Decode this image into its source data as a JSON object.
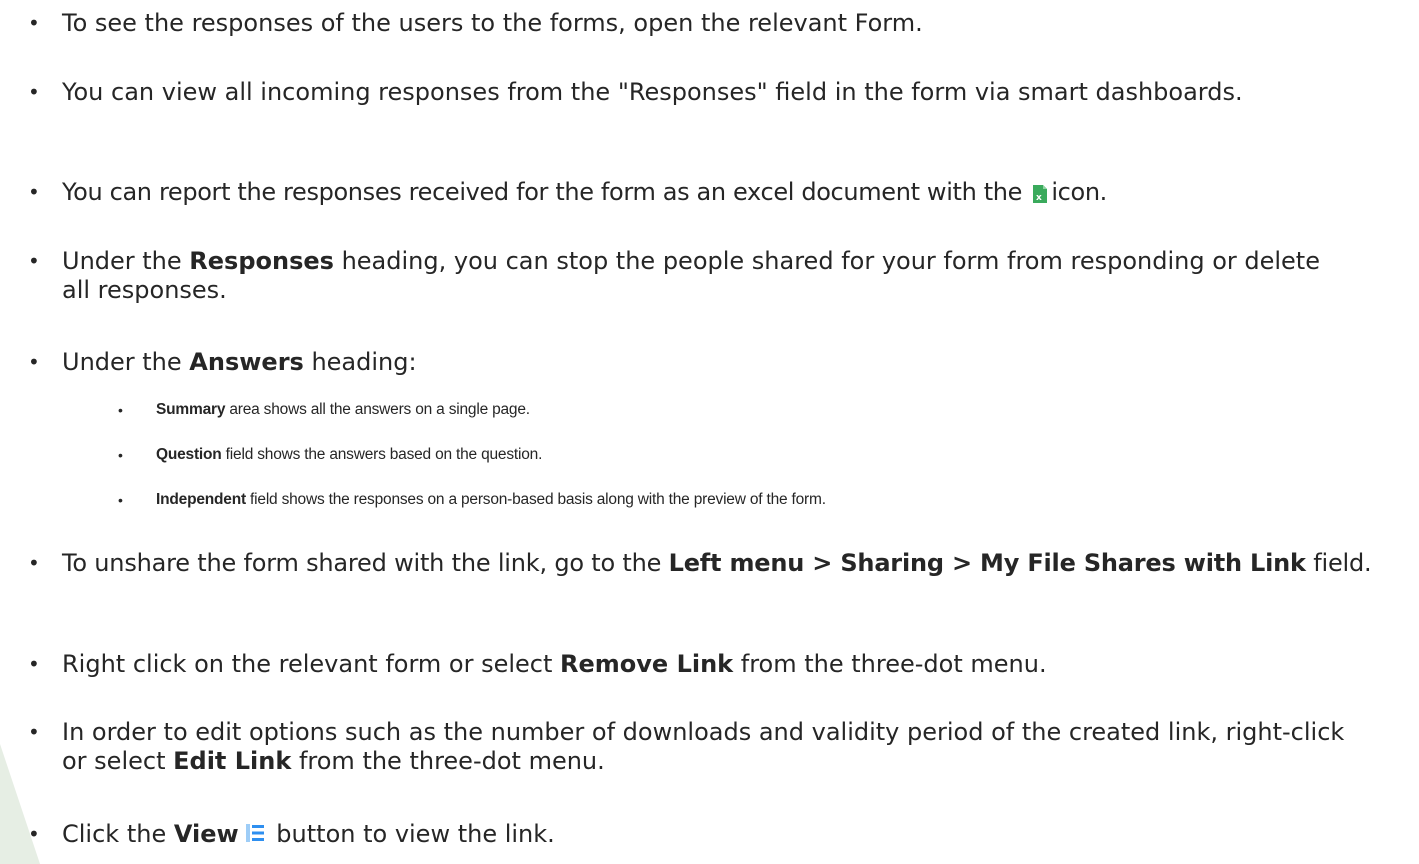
{
  "bullets": {
    "b1": "To see the responses of the users to the forms, open the relevant Form.",
    "b2": "You can view all incoming responses from the \"Responses\" field in the form via smart dashboards.",
    "b3_pre": "You can report the responses received for the form as an excel document with the ",
    "b3_post": "icon.",
    "b4_pre": "Under the ",
    "b4_bold": "Responses",
    "b4_post": " heading, you can stop the people shared for your form from responding or delete all responses.",
    "b5_pre": "Under the ",
    "b5_bold": "Answers",
    "b5_post": " heading:",
    "b6_pre": "To unshare the form shared with the link, go to the ",
    "b6_bold": "Left menu > Sharing > My File Shares with Link",
    "b6_post": " field.",
    "b7_pre": "Right click on the relevant form or select ",
    "b7_bold": "Remove Link",
    "b7_post": " from the three-dot menu.",
    "b8_pre": "In order to edit options such as the number of downloads and validity period of the created link, right-click or select ",
    "b8_bold": "Edit Link",
    "b8_post": " from the three-dot menu.",
    "b9_pre": "Click the ",
    "b9_bold": "View",
    "b9_post": " button to view the link."
  },
  "sub_bullets": {
    "s1_bold": "Summary",
    "s1_post": " area shows all the answers on a single page.",
    "s2_bold": "Question",
    "s2_post": " field shows the answers based on the question.",
    "s3_bold": "Independent",
    "s3_post": " field shows the responses on a person-based basis along with the preview of the form."
  },
  "bullet_char": "•",
  "icons": {
    "excel": "excel-file-icon",
    "view": "list-view-icon"
  },
  "colors": {
    "text": "#262626",
    "excel_green": "#3aaa5c",
    "view_blue": "#2e8ff0"
  }
}
